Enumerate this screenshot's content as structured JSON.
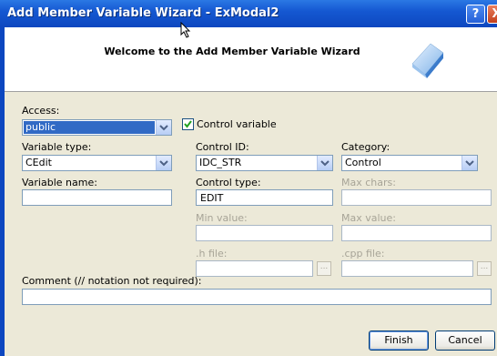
{
  "window": {
    "title": "Add Member Variable Wizard - ExModal2",
    "help_glyph": "?",
    "close_glyph": "X"
  },
  "header": {
    "title": "Welcome to the Add Member Variable Wizard"
  },
  "form": {
    "access": {
      "label": "Access:",
      "value": "public"
    },
    "control_variable": {
      "label": "Control variable",
      "checked": true
    },
    "variable_type": {
      "label": "Variable type:",
      "value": "CEdit"
    },
    "control_id": {
      "label": "Control ID:",
      "value": "IDC_STR"
    },
    "category": {
      "label": "Category:",
      "value": "Control"
    },
    "variable_name": {
      "label": "Variable name:",
      "value": ""
    },
    "control_type": {
      "label": "Control type:",
      "value": "EDIT"
    },
    "max_chars": {
      "label": "Max chars:",
      "value": ""
    },
    "min_value": {
      "label": "Min value:",
      "value": ""
    },
    "max_value": {
      "label": "Max value:",
      "value": ""
    },
    "h_file": {
      "label": ".h file:",
      "value": "",
      "browse_label": "..."
    },
    "cpp_file": {
      "label": ".cpp file:",
      "value": "",
      "browse_label": "..."
    },
    "comment": {
      "label": "Comment (// notation not required):",
      "value": ""
    }
  },
  "buttons": {
    "finish": "Finish",
    "cancel": "Cancel"
  }
}
